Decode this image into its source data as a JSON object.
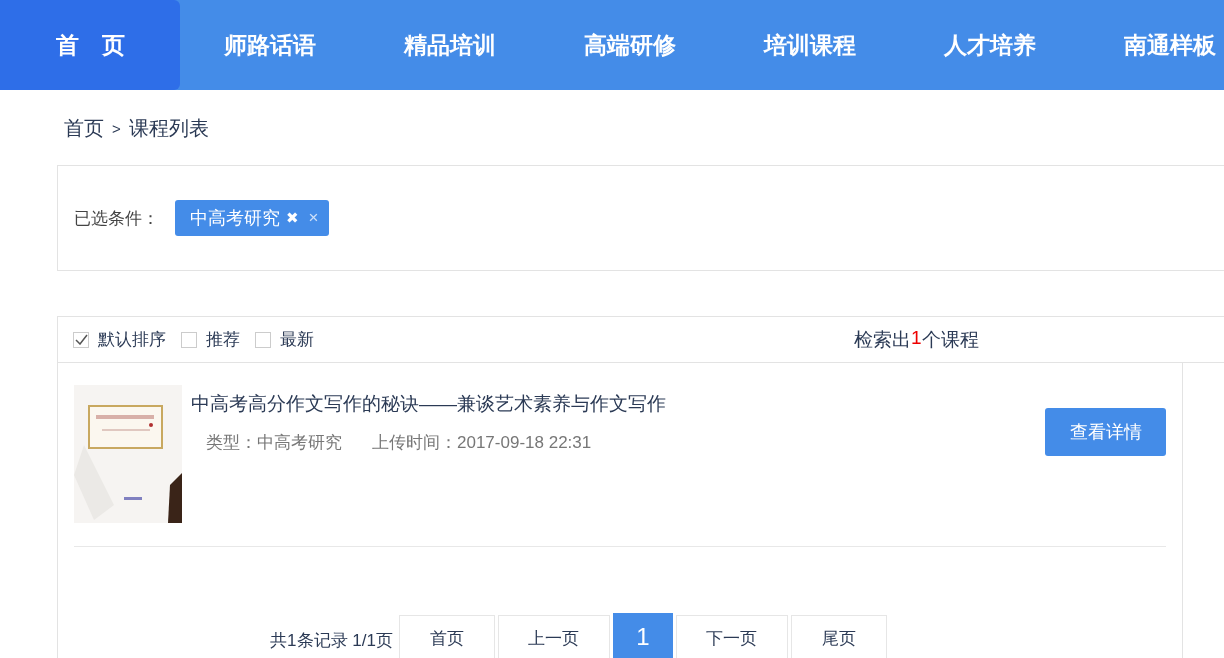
{
  "nav": [
    {
      "label": "首　页",
      "selected": true
    },
    {
      "label": "师路话语",
      "selected": false
    },
    {
      "label": "精品培训",
      "selected": false
    },
    {
      "label": "高端研修",
      "selected": false
    },
    {
      "label": "培训课程",
      "selected": false
    },
    {
      "label": "人才培养",
      "selected": false
    },
    {
      "label": "南通样板",
      "selected": false
    }
  ],
  "breadcrumb": {
    "home": "首页",
    "separator": ">",
    "current": "课程列表"
  },
  "filter": {
    "label": "已选条件：",
    "tags": [
      {
        "text": "中高考研究",
        "remove_mark": "✖",
        "close": "×"
      }
    ]
  },
  "sort_options": [
    {
      "label": "默认排序",
      "checked": true
    },
    {
      "label": "推荐",
      "checked": false
    },
    {
      "label": "最新",
      "checked": false
    }
  ],
  "result_count": {
    "prefix": "检索出",
    "count": "1",
    "suffix": "个课程"
  },
  "courses": [
    {
      "title": "中高考高分作文写作的秘诀——兼谈艺术素养与作文写作",
      "type": "类型：中高考研究",
      "uploaded": "上传时间：2017-09-18 22:31",
      "action": "查看详情"
    }
  ],
  "pagination": {
    "summary": "共1条记录 1/1页",
    "pages": [
      {
        "label": "首页",
        "kind": "nav",
        "selected": false
      },
      {
        "label": "上一页",
        "kind": "nav",
        "selected": false
      },
      {
        "label": "1",
        "kind": "number",
        "selected": true
      },
      {
        "label": "下一页",
        "kind": "nav",
        "selected": false
      },
      {
        "label": "尾页",
        "kind": "nav",
        "selected": false
      }
    ]
  }
}
